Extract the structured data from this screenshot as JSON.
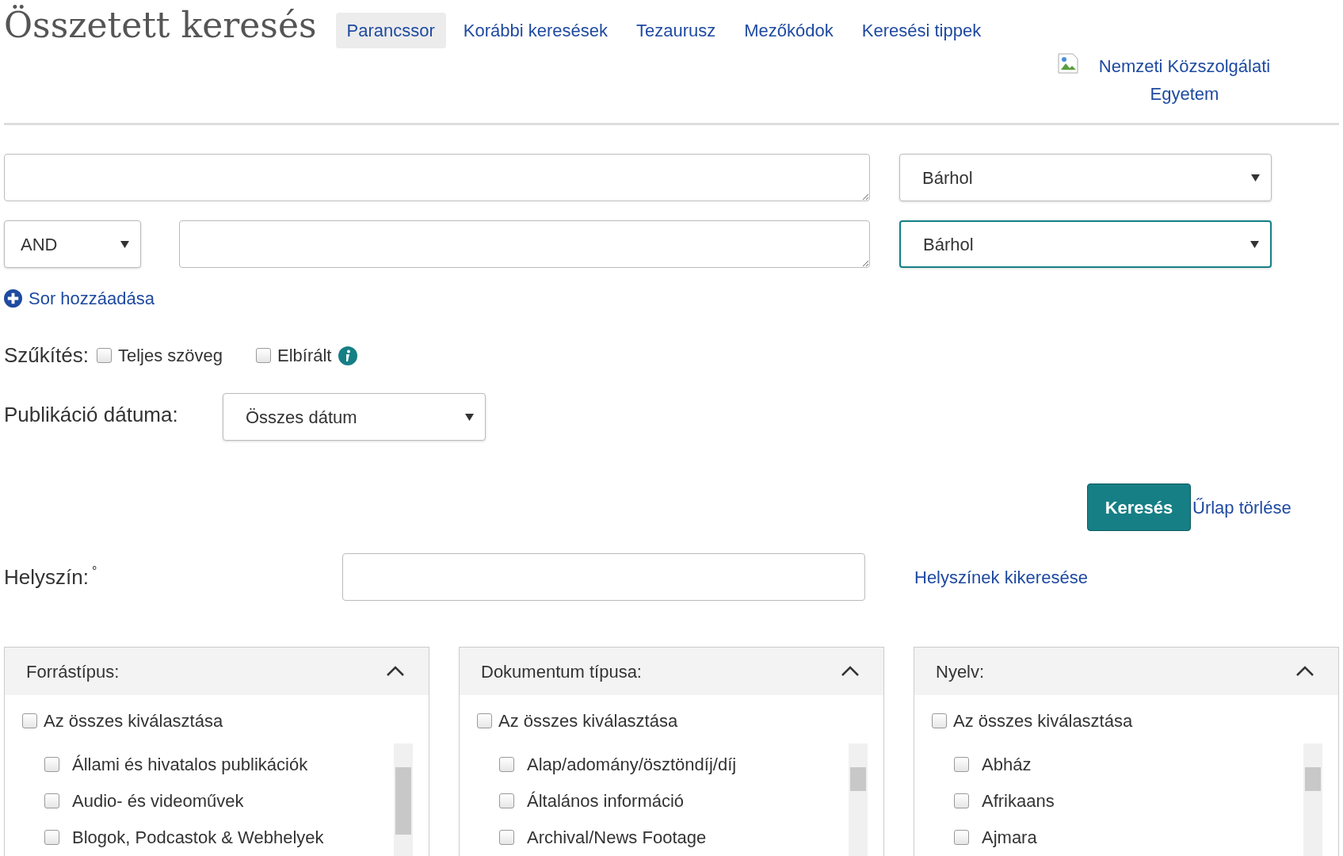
{
  "header": {
    "title": "Összetett keresés",
    "tabs": [
      {
        "label": "Parancssor",
        "selected": true
      },
      {
        "label": "Korábbi keresések",
        "selected": false
      },
      {
        "label": "Tezaurusz",
        "selected": false
      },
      {
        "label": "Mezőkódok",
        "selected": false
      },
      {
        "label": "Keresési tippek",
        "selected": false
      }
    ],
    "logo_alt": "Nemzeti Közszolgálati Egyetem"
  },
  "search_rows": [
    {
      "field": "Bárhol",
      "focused": false
    },
    {
      "operator": "AND",
      "field": "Bárhol",
      "focused": true
    }
  ],
  "add_row_link": "Sor hozzáadása",
  "narrow": {
    "label": "Szűkítés:",
    "options": [
      {
        "label": "Teljes szöveg",
        "checked": false,
        "info": false
      },
      {
        "label": "Elbírált",
        "checked": false,
        "info": true
      }
    ]
  },
  "publication_date": {
    "label": "Publikáció dátuma:",
    "value": "Összes dátum"
  },
  "actions": {
    "search": "Keresés",
    "clear": "Űrlap törlése"
  },
  "location": {
    "label": "Helyszín:",
    "marker": "°",
    "lookup_link": "Helyszínek kikeresése"
  },
  "facets": [
    {
      "title": "Forrástípus:",
      "expanded": true,
      "select_all": {
        "label": "Az összes kiválasztása",
        "checked": false
      },
      "items": [
        {
          "label": "Állami és hivatalos publikációk",
          "checked": false
        },
        {
          "label": "Audio- és videoművek",
          "checked": false
        },
        {
          "label": "Blogok, Podcastok & Webhelyek",
          "checked": false
        }
      ]
    },
    {
      "title": "Dokumentum típusa:",
      "expanded": true,
      "select_all": {
        "label": "Az összes kiválasztása",
        "checked": false
      },
      "items": [
        {
          "label": "Alap/adomány/ösztöndíj/díj",
          "checked": false
        },
        {
          "label": "Általános információ",
          "checked": false
        },
        {
          "label": "Archival/News Footage",
          "checked": false
        }
      ]
    },
    {
      "title": "Nyelv:",
      "expanded": true,
      "select_all": {
        "label": "Az összes kiválasztása",
        "checked": false
      },
      "items": [
        {
          "label": "Abház",
          "checked": false
        },
        {
          "label": "Afrikaans",
          "checked": false
        },
        {
          "label": "Ajmara",
          "checked": false
        }
      ]
    }
  ]
}
